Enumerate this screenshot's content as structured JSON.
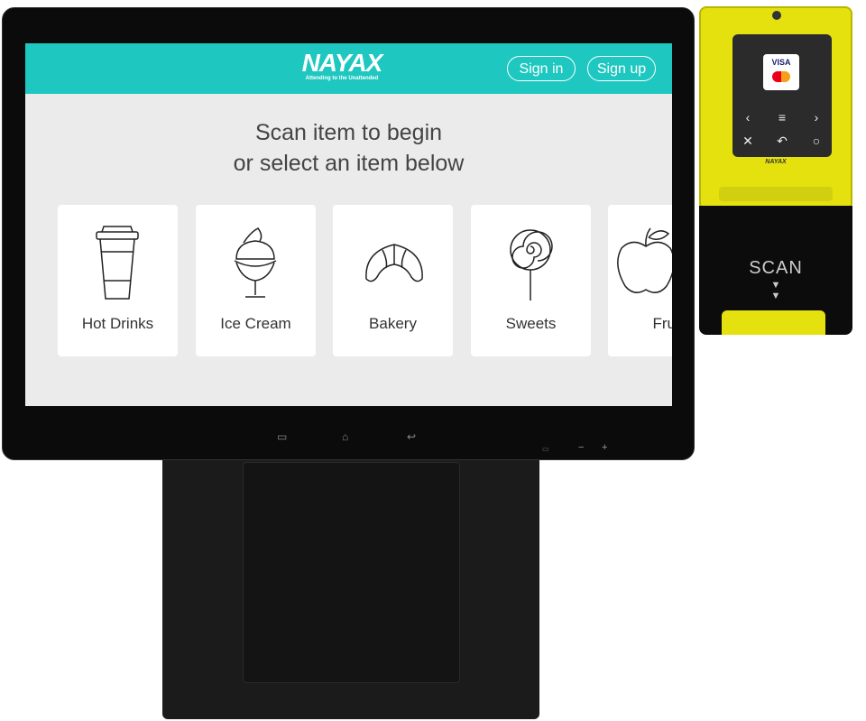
{
  "header": {
    "logo": "NAYAX",
    "tagline": "Attending to the Unattended",
    "sign_in": "Sign in",
    "sign_up": "Sign up"
  },
  "main": {
    "title_line1": "Scan item to begin",
    "title_line2": "or select an item below",
    "categories": [
      {
        "label": "Hot Drinks",
        "icon": "coffee-cup-icon"
      },
      {
        "label": "Ice Cream",
        "icon": "ice-cream-icon"
      },
      {
        "label": "Bakery",
        "icon": "croissant-icon"
      },
      {
        "label": "Sweets",
        "icon": "lollipop-icon"
      },
      {
        "label": "Fruit",
        "icon": "apple-icon"
      }
    ]
  },
  "device": {
    "nav_buttons": [
      "menu-icon",
      "home-icon",
      "back-icon"
    ],
    "volume_minus": "−",
    "volume_plus": "+"
  },
  "reader": {
    "brand": "NAYAX",
    "card_visa": "VISA",
    "keys": [
      "‹",
      "≡",
      "›",
      "✕",
      "↶",
      "○"
    ],
    "scan_label": "SCAN"
  },
  "colors": {
    "accent": "#1ec8c0",
    "reader_yellow": "#e4e10f"
  }
}
